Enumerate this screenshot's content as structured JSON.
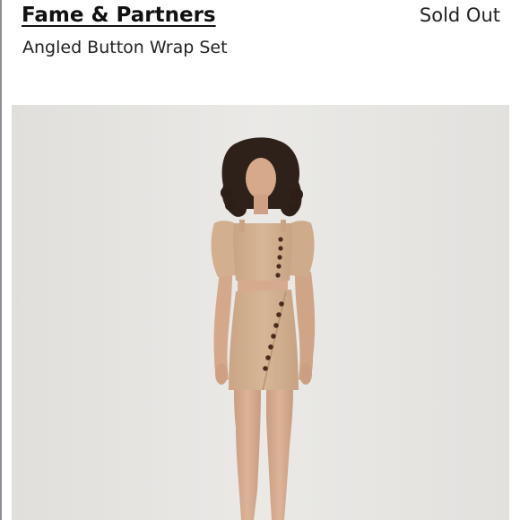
{
  "header": {
    "brand": "Fame & Partners",
    "status": "Sold Out",
    "product_name": "Angled Button Wrap Set"
  },
  "colors": {
    "backdrop": "#e6e5e2",
    "garment": "#d2b090",
    "skin": "#dbb093",
    "hair": "#2e211a",
    "buttons": "#4a2a1c"
  }
}
